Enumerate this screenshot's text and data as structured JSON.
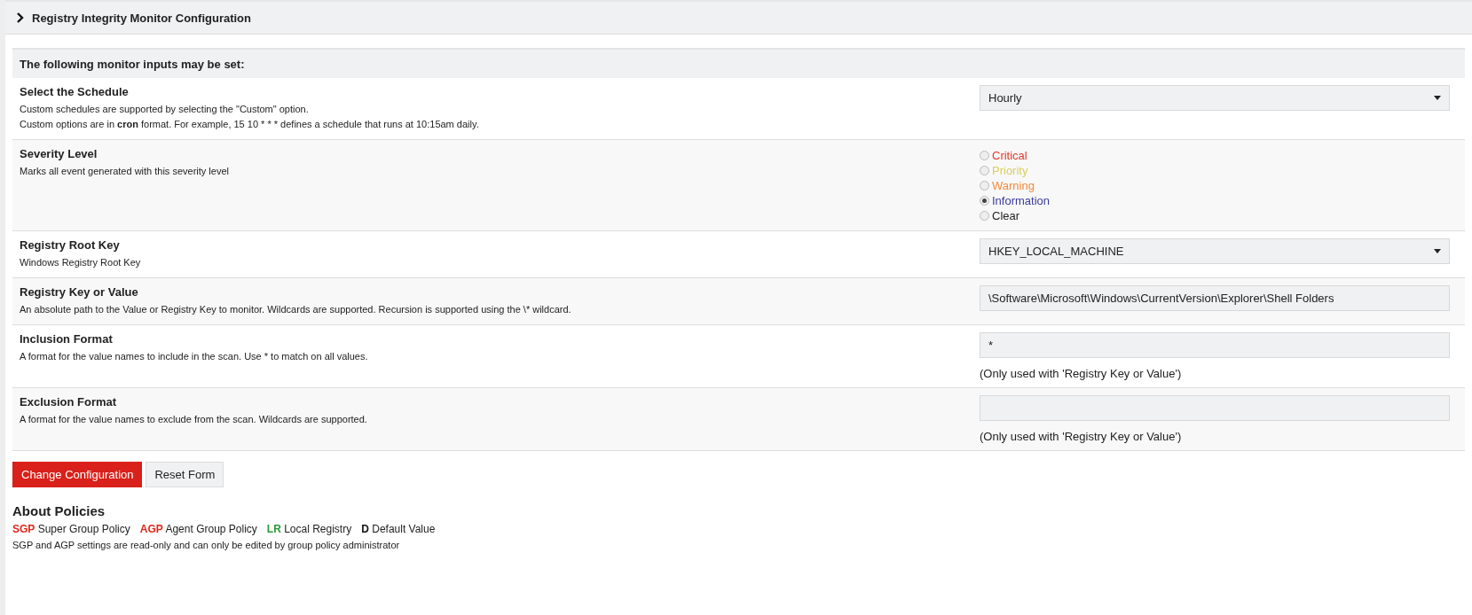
{
  "panel": {
    "title": "Registry Integrity Monitor Configuration",
    "expanded": true
  },
  "section": {
    "heading": "The following monitor inputs may be set:"
  },
  "rows": [
    {
      "kind": "select",
      "title": "Select the Schedule",
      "description": [
        "Custom schedules are supported by selecting the \"Custom\" option.",
        "Custom options are in **cron** format. For example, 15 10 * * * defines a schedule that runs at 10:15am daily."
      ],
      "value": "Hourly"
    },
    {
      "kind": "radio",
      "title": "Severity Level",
      "description": [
        "Marks all event generated with this severity level"
      ],
      "options": [
        {
          "label": "Critical",
          "color": "#e0382a",
          "selected": false
        },
        {
          "label": "Priority",
          "color": "#d9cf5c",
          "selected": false
        },
        {
          "label": "Warning",
          "color": "#f28a3c",
          "selected": false
        },
        {
          "label": "Information",
          "color": "#3c3c9c",
          "selected": true
        },
        {
          "label": "Clear",
          "color": "#222222",
          "selected": false
        }
      ]
    },
    {
      "kind": "select",
      "title": "Registry Root Key",
      "description": [
        "Windows Registry Root Key"
      ],
      "value": "HKEY_LOCAL_MACHINE"
    },
    {
      "kind": "text",
      "title": "Registry Key or Value",
      "description": [
        "An absolute path to the Value or Registry Key to monitor. Wildcards are supported. Recursion is supported using the \\* wildcard."
      ],
      "value": "\\Software\\Microsoft\\Windows\\CurrentVersion\\Explorer\\Shell Folders"
    },
    {
      "kind": "text",
      "title": "Inclusion Format",
      "description": [
        "A format for the value names to include in the scan. Use * to match on all values."
      ],
      "value": "*",
      "note": "(Only used with 'Registry Key or Value')"
    },
    {
      "kind": "text",
      "title": "Exclusion Format",
      "description": [
        "A format for the value names to exclude from the scan. Wildcards are supported."
      ],
      "note": "(Only used with 'Registry Key or Value')"
    }
  ],
  "buttons": [
    {
      "kind": "primary",
      "label": "Change Configuration"
    },
    {
      "kind": "secondary",
      "label": "Reset Form"
    }
  ],
  "about": {
    "heading": "About Policies",
    "legend": [
      {
        "code": "SGP",
        "label": "Super Group Policy",
        "color": "#e0281c"
      },
      {
        "code": "AGP",
        "label": "Agent Group Policy",
        "color": "#e0281c"
      },
      {
        "code": "LR",
        "label": "Local Registry",
        "color": "#2a9a3a"
      },
      {
        "code": "D",
        "label": "Default Value",
        "color": "#111111"
      }
    ],
    "note": "SGP and AGP settings are read-only and can only be edited by group policy administrator"
  }
}
